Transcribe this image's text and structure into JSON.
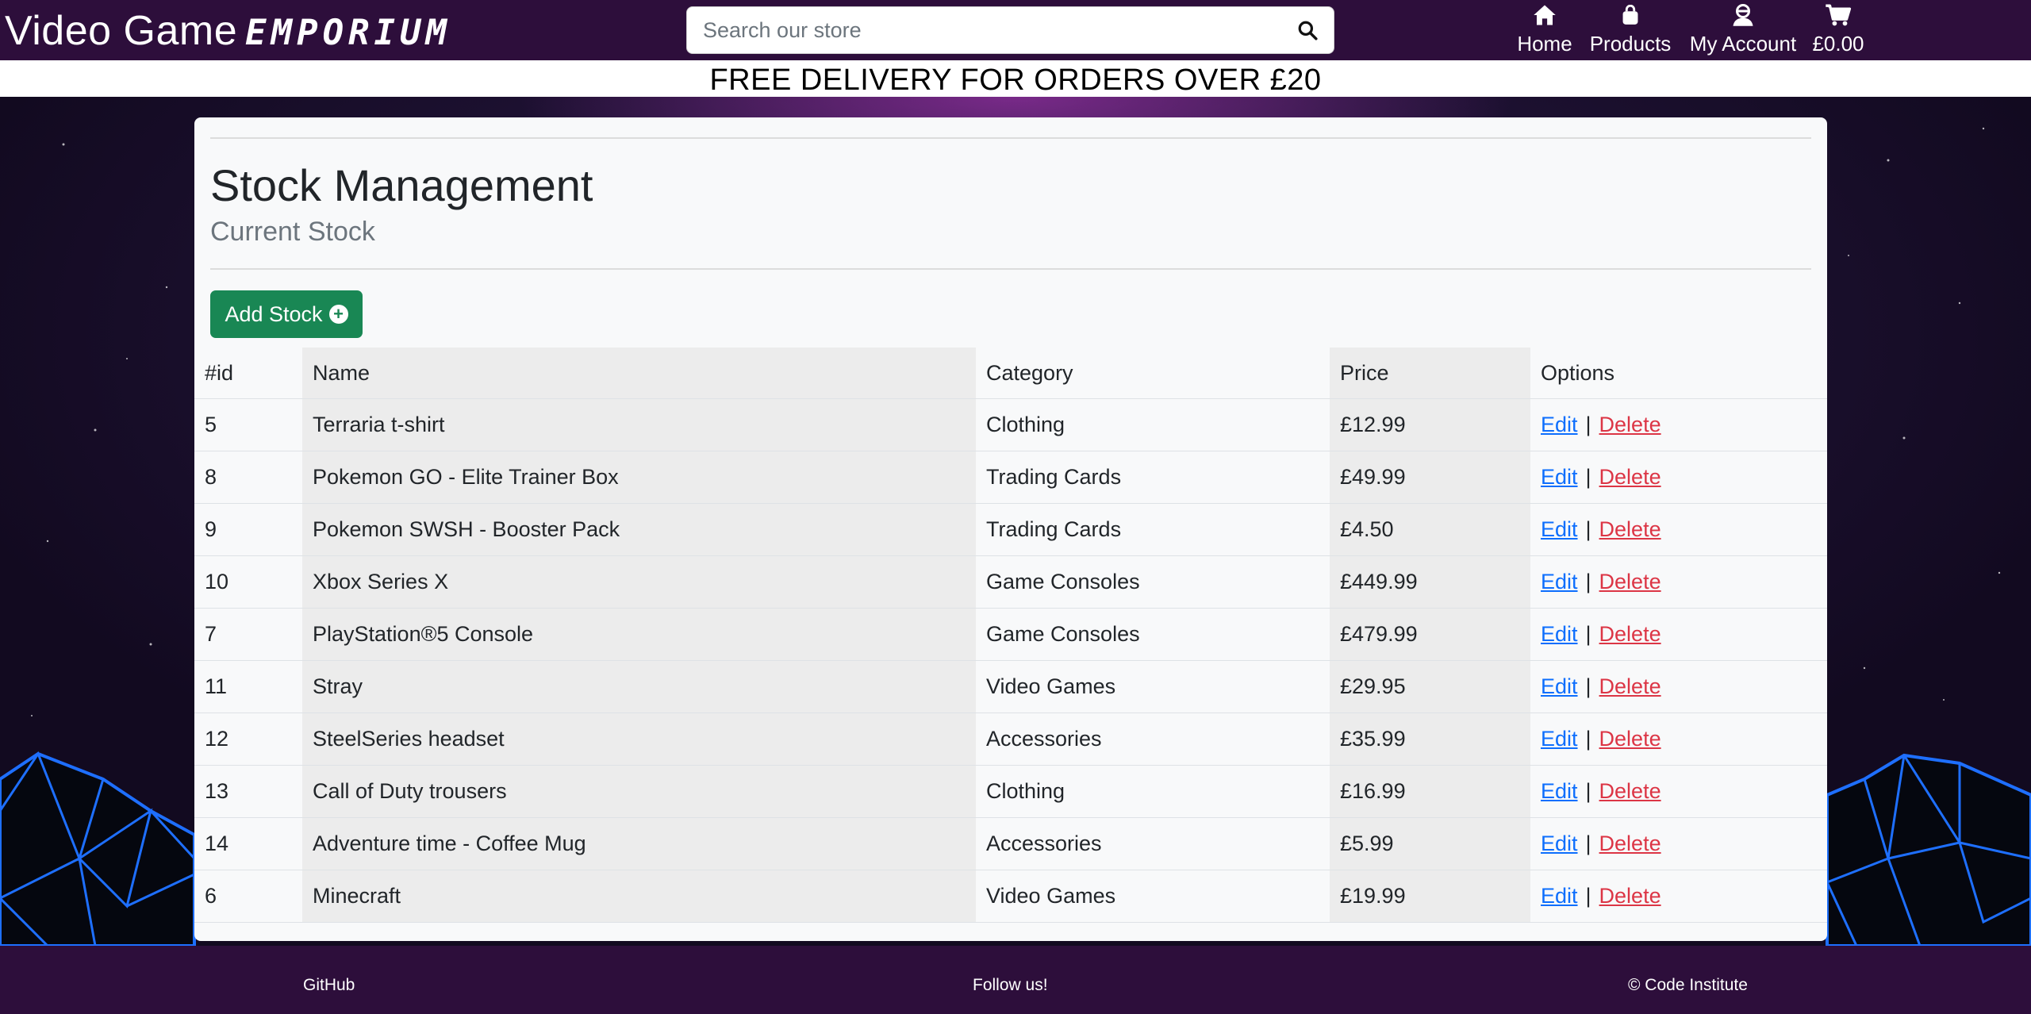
{
  "brand": {
    "plain": "Video Game",
    "stylized": "EMPORIUM"
  },
  "search": {
    "placeholder": "Search our store"
  },
  "nav": [
    {
      "label": "Home",
      "icon": "home-icon"
    },
    {
      "label": "Products",
      "icon": "shopping-bag-icon"
    },
    {
      "label": "My Account",
      "icon": "user-icon"
    },
    {
      "label": "£0.00",
      "icon": "cart-icon"
    }
  ],
  "banner": "FREE DELIVERY FOR ORDERS OVER £20",
  "page": {
    "title": "Stock Management",
    "subtitle": "Current Stock",
    "add_button": "Add Stock"
  },
  "table": {
    "headers": [
      "#id",
      "Name",
      "Category",
      "Price",
      "Options"
    ],
    "rows": [
      {
        "id": "5",
        "name": "Terraria t-shirt",
        "category": "Clothing",
        "price": "£12.99"
      },
      {
        "id": "8",
        "name": "Pokemon GO - Elite Trainer Box",
        "category": "Trading Cards",
        "price": "£49.99"
      },
      {
        "id": "9",
        "name": "Pokemon SWSH - Booster Pack",
        "category": "Trading Cards",
        "price": "£4.50"
      },
      {
        "id": "10",
        "name": "Xbox Series X",
        "category": "Game Consoles",
        "price": "£449.99"
      },
      {
        "id": "7",
        "name": "PlayStation®5 Console",
        "category": "Game Consoles",
        "price": "£479.99"
      },
      {
        "id": "11",
        "name": "Stray",
        "category": "Video Games",
        "price": "£29.95"
      },
      {
        "id": "12",
        "name": "SteelSeries headset",
        "category": "Accessories",
        "price": "£35.99"
      },
      {
        "id": "13",
        "name": "Call of Duty trousers",
        "category": "Clothing",
        "price": "£16.99"
      },
      {
        "id": "14",
        "name": "Adventure time - Coffee Mug",
        "category": "Accessories",
        "price": "£5.99"
      },
      {
        "id": "6",
        "name": "Minecraft",
        "category": "Video Games",
        "price": "£19.99"
      }
    ],
    "edit_label": "Edit",
    "separator": "|",
    "delete_label": "Delete"
  },
  "footer": {
    "github": "GitHub",
    "follow": "Follow us!",
    "copyright": "© Code Institute"
  },
  "colors": {
    "header_bg": "#2d0e3b",
    "add_button": "#198754",
    "edit_link": "#0d6efd",
    "delete_link": "#dc3545",
    "grid_lines": "#1e6fff"
  }
}
